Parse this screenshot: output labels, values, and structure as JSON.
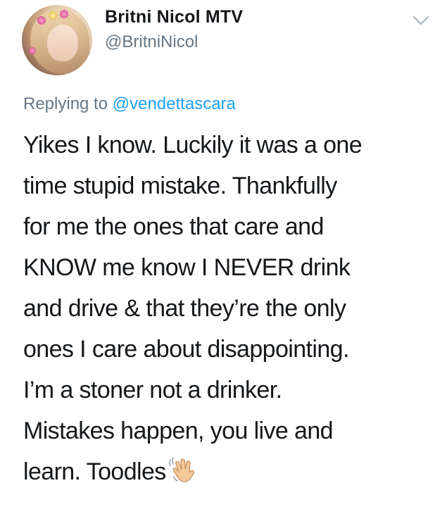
{
  "author": {
    "display_name": "Britni Nicol MTV",
    "handle": "@BritniNicol",
    "avatar_icon": "profile-photo"
  },
  "reply": {
    "prefix": "Replying to ",
    "mention": "@vendettascara"
  },
  "tweet": {
    "lines": [
      "Yikes I know. Luckily it was a one",
      "time stupid mistake. Thankfully",
      "for me the ones that care and",
      "KNOW me know I NEVER drink",
      "and drive & that they’re the only",
      "ones I care about disappointing.",
      "I’m a stoner not a drinker.",
      "Mistakes happen, you live and",
      "learn. Toodles"
    ],
    "emoji_icon": "waving-hand-icon"
  },
  "menu_icon": "chevron-down-icon",
  "colors": {
    "text": "#14171a",
    "secondary": "#657786",
    "link": "#1da1f2"
  }
}
